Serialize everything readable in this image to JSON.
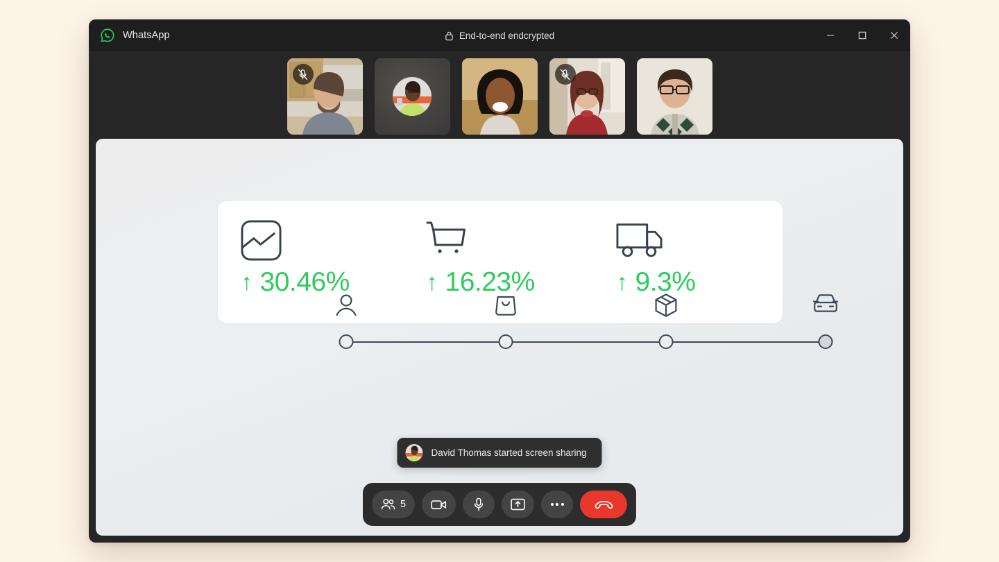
{
  "window": {
    "app_name": "WhatsApp",
    "app_logo_icon": "whatsapp-logo-icon",
    "encryption_label": "End-to-end endcrypted",
    "lock_icon": "lock-icon",
    "controls": {
      "minimize": "minimize-icon",
      "maximize": "maximize-icon",
      "close": "close-icon"
    }
  },
  "participants": {
    "count_label": "5",
    "tiles": [
      {
        "name": "participant-1",
        "muted": true,
        "kind": "video",
        "mute_icon": "mic-off-icon"
      },
      {
        "name": "participant-2",
        "muted": false,
        "kind": "avatar",
        "mute_icon": ""
      },
      {
        "name": "participant-3",
        "muted": false,
        "kind": "video",
        "mute_icon": ""
      },
      {
        "name": "participant-4",
        "muted": true,
        "kind": "video",
        "mute_icon": "mic-off-icon"
      },
      {
        "name": "participant-5",
        "muted": false,
        "kind": "video",
        "mute_icon": ""
      }
    ]
  },
  "shared_screen": {
    "stats": [
      {
        "icon": "image-chart-icon",
        "arrow": "↑",
        "value": "30.46%"
      },
      {
        "icon": "shopping-cart-icon",
        "arrow": "↑",
        "value": "16.23%"
      },
      {
        "icon": "delivery-truck-icon",
        "arrow": "↑",
        "value": "9.3%"
      }
    ],
    "timeline": {
      "steps": [
        {
          "icon": "user-icon",
          "filled": false
        },
        {
          "icon": "shopping-bag-icon",
          "filled": false
        },
        {
          "icon": "package-box-icon",
          "filled": false
        },
        {
          "icon": "car-icon",
          "filled": true
        }
      ]
    }
  },
  "toast": {
    "avatar_icon": "avatar-icon",
    "message": "David Thomas started screen sharing"
  },
  "call_controls": [
    {
      "name": "participants-button",
      "icon": "people-icon",
      "label": "5"
    },
    {
      "name": "camera-button",
      "icon": "video-camera-icon",
      "label": ""
    },
    {
      "name": "microphone-button",
      "icon": "microphone-icon",
      "label": ""
    },
    {
      "name": "share-screen-button",
      "icon": "share-screen-icon",
      "label": ""
    },
    {
      "name": "more-options-button",
      "icon": "more-dots-icon",
      "label": ""
    },
    {
      "name": "end-call-button",
      "icon": "hangup-phone-icon",
      "label": ""
    }
  ],
  "colors": {
    "page_background": "#fdf3e7",
    "window_chrome": "#262626",
    "titlebar": "#1e1e1e",
    "brand_green": "#25d366",
    "stat_green": "#2ecc5f",
    "icon_slate": "#3d4a57",
    "hangup_red": "#e8382c"
  }
}
